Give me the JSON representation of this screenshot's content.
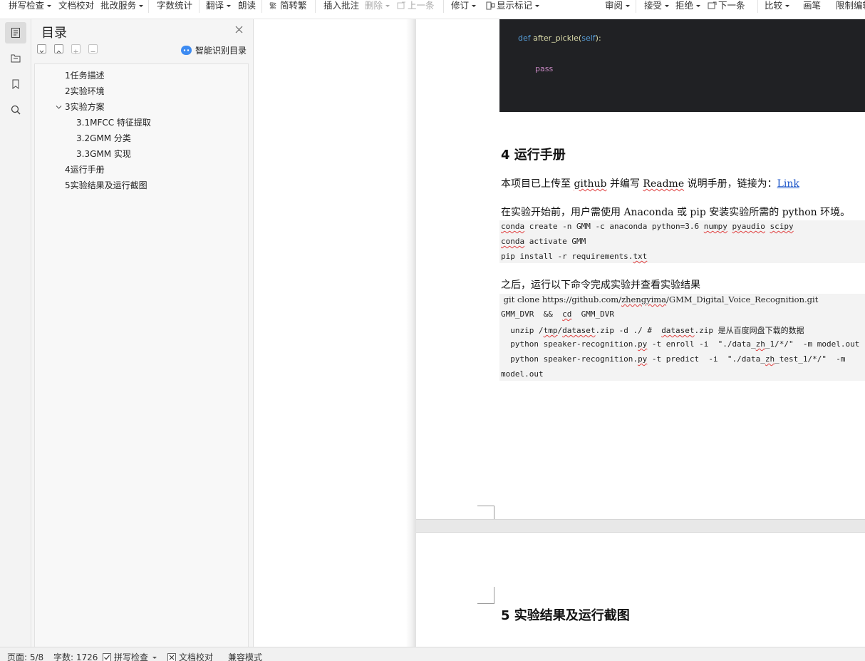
{
  "ribbon": {
    "spell_check": "拼写检查",
    "doc_proof": "文档校对",
    "review_service": "批改服务",
    "word_count": "字数统计",
    "translate": "翻译",
    "read_aloud": "朗读",
    "simp_trad": "简转繁",
    "insert_comment": "插入批注",
    "delete": "删除",
    "prev": "上一条",
    "revise": "修订",
    "show_marks": "显示标记",
    "review": "审阅",
    "accept": "接受",
    "reject": "拒绝",
    "next": "下一条",
    "compare": "比较",
    "pen": "画笔",
    "restrict_edit": "限制编辑"
  },
  "toc": {
    "title": "目录",
    "smart_label": "智能识别目录",
    "items": [
      {
        "label": "1任务描述"
      },
      {
        "label": "2实验环境"
      },
      {
        "label": "3实验方案"
      },
      {
        "label": "3.1MFCC 特征提取"
      },
      {
        "label": "3.2GMM 分类"
      },
      {
        "label": "3.3GMM 实现"
      },
      {
        "label": "4运行手册"
      },
      {
        "label": "5实验结果及运行截图"
      }
    ]
  },
  "document": {
    "code_dark": {
      "line1_kw": "def",
      "line1_fn": " after_pickle(",
      "line1_self": "self",
      "line1_end": "):",
      "line2": "pass"
    },
    "section4_heading": "4  运行手册",
    "para1_a": "本项目已上传至 ",
    "para1_github": "github",
    "para1_b": " 并编写 ",
    "para1_readme": "Readme",
    "para1_c": " 说明手册，链接为：",
    "para1_link": "Link",
    "para2": "在实验开始前，用户需使用 Anaconda 或 pip 安装实验所需的 python 环境。",
    "code1": {
      "l1_a": "conda",
      "l1_b": " create -n GMM -c anaconda python=3.6 ",
      "l1_c": "numpy",
      "l1_d": " ",
      "l1_e": "pyaudio",
      "l1_f": " ",
      "l1_g": "scipy",
      "l2_a": "conda",
      "l2_b": " activate GMM",
      "l3_a": "pip install -r requirements.",
      "l3_b": "txt"
    },
    "para3": "之后，运行以下命令完成实验并查看实验结果",
    "code2": {
      "git_a": " git clone https://github.com/",
      "git_b": "zhengyima",
      "git_c": "/GMM_Digital_Voice_Recognition.git",
      "l2_a": "GMM_DVR  &&  ",
      "l2_b": "cd",
      "l2_c": "  GMM_DVR",
      "l3_a": "  unzip /",
      "l3_b": "tmp",
      "l3_c": "/",
      "l3_d": "dataset",
      "l3_e": ".zip -d ./ #  ",
      "l3_f": "dataset",
      "l3_g": ".zip 是从百度网盘下载的数据",
      "l4_a": "  python speaker-recognition.",
      "l4_b": "py",
      "l4_c": " -t enroll -i  \"./data_",
      "l4_d": "zh",
      "l4_e": "_1/*/\"  -m model.out",
      "l5_a": "  python speaker-recognition.",
      "l5_b": "py",
      "l5_c": " -t predict  -i  \"./data_",
      "l5_d": "zh",
      "l5_e": "_test_1/*/\"  -m",
      "l6": "model.out"
    },
    "section5_heading": "5  实验结果及运行截图"
  },
  "status": {
    "page": "页面: 5/8",
    "words": "字数: 1726",
    "spell": "拼写检查",
    "proof": "文档校对",
    "compat": "兼容模式"
  },
  "colors": {
    "accent_blue": "#3d8bf2",
    "link": "#1c55c8",
    "code_bg_dark": "#202124",
    "keyword_blue": "#569cd6",
    "keyword_pink": "#c586c0"
  }
}
